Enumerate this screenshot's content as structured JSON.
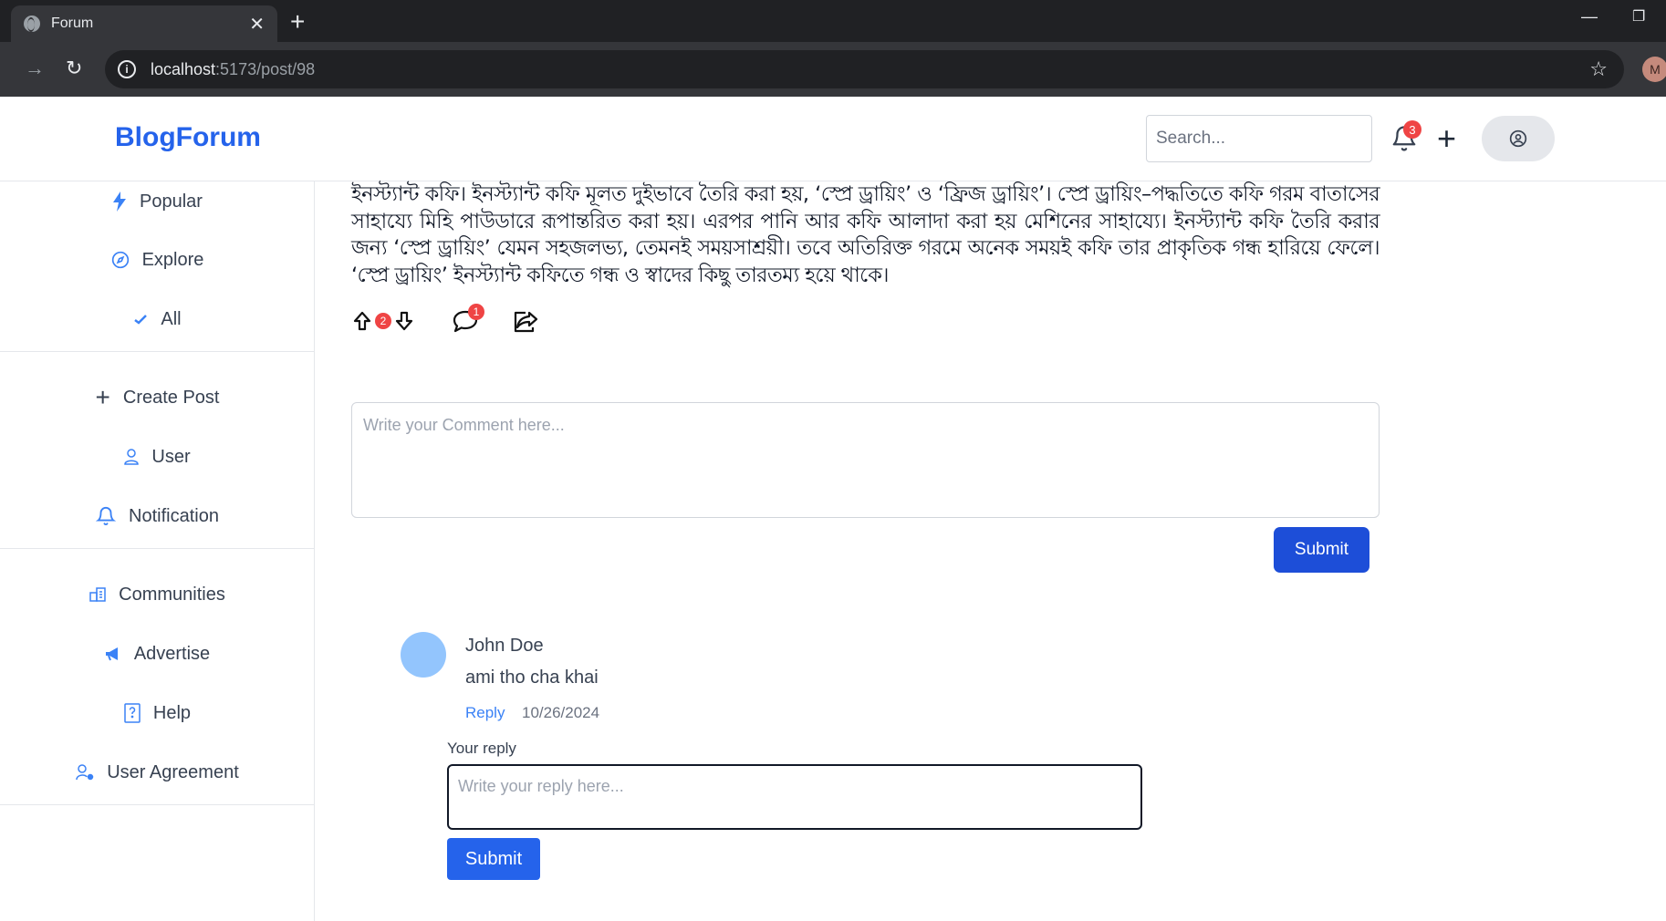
{
  "browser": {
    "tab_title": "Forum",
    "url_host": "localhost",
    "url_path": ":5173/post/98",
    "profile_initial": "M"
  },
  "header": {
    "logo": "BlogForum",
    "search_placeholder": "Search...",
    "notification_count": "3",
    "accent_color": "#2563eb"
  },
  "sidebar": {
    "items": [
      {
        "label": "Popular",
        "icon": "lightning-icon"
      },
      {
        "label": "Explore",
        "icon": "compass-icon"
      },
      {
        "label": "All",
        "icon": "check-icon"
      },
      {
        "label": "Create Post",
        "icon": "plus-icon"
      },
      {
        "label": "User",
        "icon": "user-icon"
      },
      {
        "label": "Notification",
        "icon": "bell-icon"
      },
      {
        "label": "Communities",
        "icon": "building-icon"
      },
      {
        "label": "Advertise",
        "icon": "megaphone-icon"
      },
      {
        "label": "Help",
        "icon": "help-book-icon"
      },
      {
        "label": "User Agreement",
        "icon": "user-gear-icon"
      }
    ]
  },
  "post": {
    "body": "ইনস্ট্যান্ট কফি। ইনস্ট্যান্ট কফি মূলত দুইভাবে তৈরি করা হয়, ‘স্প্রে ড্রায়িং’ ও ‘ফ্রিজ ড্রায়িং’। স্প্রে ড্রায়িং–পদ্ধতিতে কফি গরম বাতাসের সাহায্যে মিহি পাউডারে রূপান্তরিত করা হয়। এরপর পানি আর কফি আলাদা করা হয় মেশিনের সাহায্যে। ইনস্ট্যান্ট কফি তৈরি করার জন্য ‘স্প্রে ড্রায়িং’ যেমন সহজলভ্য, তেমনই সময়সাশ্রয়ী। তবে অতিরিক্ত গরমে অনেক সময়ই কফি তার প্রাকৃতিক গন্ধ হারিয়ে ফেলে। ‘স্প্রে ড্রায়িং’ ইনস্ট্যান্ট কফিতে গন্ধ ও স্বাদের কিছু তারতম্য হয়ে থাকে।",
    "vote_count": "2",
    "comment_count": "1"
  },
  "comment_form": {
    "placeholder": "Write your Comment here...",
    "submit_label": "Submit"
  },
  "comments": [
    {
      "author": "John Doe",
      "text": "ami tho cha khai",
      "reply_label": "Reply",
      "date": "10/26/2024"
    }
  ],
  "reply_form": {
    "label": "Your reply",
    "placeholder": "Write your reply here...",
    "submit_label": "Submit"
  }
}
